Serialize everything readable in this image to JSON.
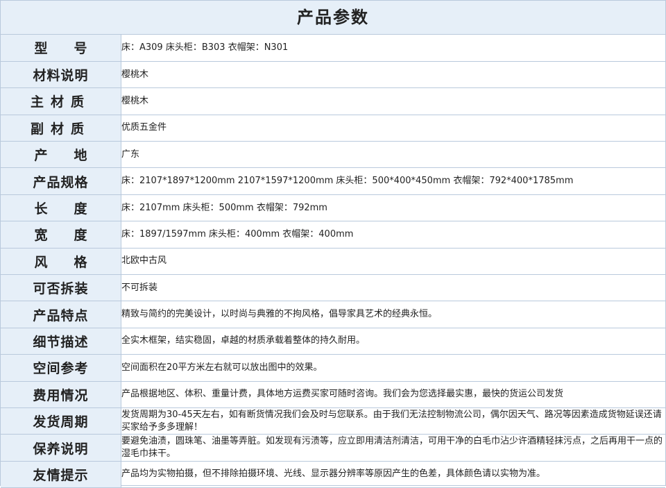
{
  "title": "产品参数",
  "rows": [
    {
      "label": "型号",
      "value": "床：A309  床头柜：B303  衣帽架：N301"
    },
    {
      "label": "材料说明",
      "value": "樱桃木"
    },
    {
      "label": "主材质",
      "value": "樱桃木"
    },
    {
      "label": "副材质",
      "value": "优质五金件"
    },
    {
      "label": "产地",
      "value": "广东"
    },
    {
      "label": "产品规格",
      "value": "床：2107*1897*1200mm  2107*1597*1200mm  床头柜：500*400*450mm  衣帽架：792*400*1785mm"
    },
    {
      "label": "长度",
      "value": "床：2107mm  床头柜：500mm  衣帽架：792mm"
    },
    {
      "label": "宽度",
      "value": "床：1897/1597mm  床头柜：400mm  衣帽架：400mm"
    },
    {
      "label": "风格",
      "value": "北欧中古风"
    },
    {
      "label": "可否拆装",
      "value": "不可拆装"
    },
    {
      "label": "产品特点",
      "value": "精致与简约的完美设计，以时尚与典雅的不拘风格，倡导家具艺术的经典永恒。"
    },
    {
      "label": "细节描述",
      "value": "全实木框架，结实稳固，卓越的材质承载着整体的持久耐用。"
    },
    {
      "label": "空间参考",
      "value": "空间面积在20平方米左右就可以放出图中的效果。"
    },
    {
      "label": "费用情况",
      "value": "产品根据地区、体积、重量计费，具体地方运费买家可随时咨询。我们会为您选择最实惠，最快的货运公司发货"
    },
    {
      "label": "发货周期",
      "value": "发货周期为30-45天左右，如有断货情况我们会及时与您联系。由于我们无法控制物流公司，偶尔因天气、路况等因素造成货物延误还请买家给予多多理解！"
    },
    {
      "label": "保养说明",
      "value": "要避免油渍，圆珠笔、油墨等弄脏。如发现有污渍等，应立即用清洁剂清洁，可用干净的白毛巾沾少许酒精轻抹污点，之后再用干一点的湿毛巾抹干。"
    },
    {
      "label": "友情提示",
      "value": "产品均为实物拍摄，但不排除拍摄环境、光线、显示器分辨率等原因产生的色差，具体颜色请以实物为准。"
    }
  ]
}
